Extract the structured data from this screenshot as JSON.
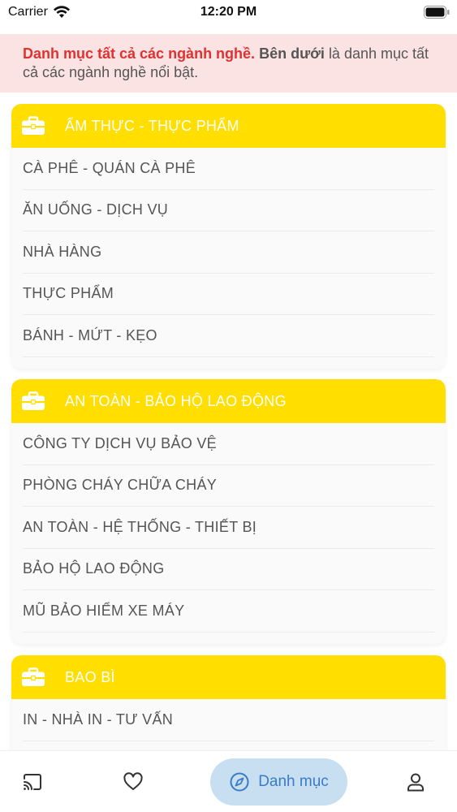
{
  "status_bar": {
    "carrier": "Carrier",
    "time": "12:20 PM"
  },
  "notice": {
    "highlight": "Danh mục tất cả các ngành nghề.",
    "bold": "Bên dưới",
    "rest": "là danh mục tất cả các ngành nghề nổi bật."
  },
  "categories": [
    {
      "title": "ẨM THỰC - THỰC PHẨM",
      "items": [
        "CÀ PHÊ - QUÁN CÀ PHÊ",
        "ĂN UỐNG - DỊCH VỤ",
        "NHÀ HÀNG",
        "THỰC PHẨM",
        "BÁNH - MỨT - KẸO"
      ]
    },
    {
      "title": "AN TOÀN - BẢO HỘ LAO ĐỘNG",
      "items": [
        "CÔNG TY DỊCH VỤ BẢO VỆ",
        "PHÒNG CHÁY CHỮA CHÁY",
        "AN TOÀN - HỆ THỐNG - THIẾT BỊ",
        "BẢO HỘ LAO ĐỘNG",
        "MŨ BẢO HIỂM XE MÁY"
      ]
    },
    {
      "title": "BAO BÌ",
      "items": [
        "IN - NHÀ IN - TƯ VẤN"
      ]
    }
  ],
  "tabbar": {
    "active_label": "Danh mục",
    "icons": [
      "cast-icon",
      "heart-icon",
      "compass-icon",
      "user-icon"
    ]
  },
  "colors": {
    "header_yellow": "#ffde00",
    "notice_bg": "#fbe3e3",
    "notice_red": "#e03131",
    "active_tab_bg": "#c7dff0",
    "active_tab_text": "#3a7cc4"
  }
}
